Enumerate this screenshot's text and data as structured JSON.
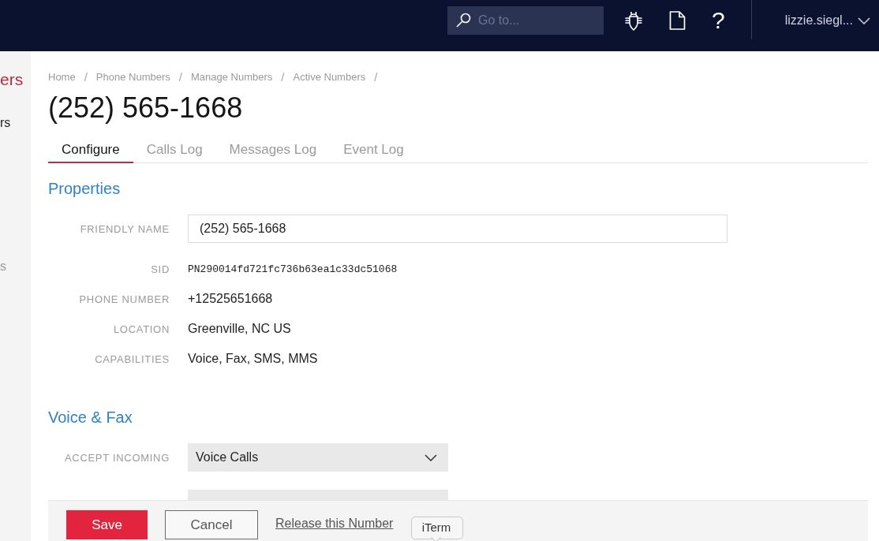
{
  "top_bar": {
    "search": {
      "placeholder": "Go to..."
    },
    "help": "?",
    "user": {
      "name": "lizzie.siegl...",
      "expanded": false
    }
  },
  "sidebar": {
    "heading": "ers",
    "items": [
      {
        "label": "rs",
        "selected": true
      },
      {
        "label": "s",
        "selected": false
      }
    ]
  },
  "breadcrumb": [
    {
      "label": "Home",
      "separator": "/"
    },
    {
      "label": "Phone Numbers",
      "separator": "/"
    },
    {
      "label": "Manage Numbers",
      "separator": "/"
    },
    {
      "label": "Active Numbers",
      "separator": "/"
    }
  ],
  "title": "(252) 565-1668",
  "tabs": [
    {
      "label": "Configure",
      "selected": true
    },
    {
      "label": "Calls Log",
      "selected": false
    },
    {
      "label": "Messages Log",
      "selected": false
    },
    {
      "label": "Event Log",
      "selected": false
    }
  ],
  "sections": [
    {
      "title": "Properties",
      "fields": [
        {
          "kind": "input",
          "label": "FRIENDLY NAME",
          "value": "(252) 565-1668"
        },
        {
          "kind": "code",
          "label": "SID",
          "value": "PN290014fd721fc736b63ea1c33dc51068"
        },
        {
          "kind": "text",
          "label": "PHONE NUMBER",
          "value": "+12525651668"
        },
        {
          "kind": "text",
          "label": "LOCATION",
          "value": "Greenville, NC US"
        },
        {
          "kind": "text",
          "label": "CAPABILITIES",
          "value": "Voice, Fax, SMS, MMS"
        }
      ]
    },
    {
      "title": "Voice & Fax",
      "fields": [
        {
          "kind": "select",
          "label": "ACCEPT INCOMING",
          "value": "Voice Calls"
        },
        {
          "kind": "covered_select"
        }
      ]
    }
  ],
  "footer": {
    "buttons": [
      {
        "kind": "primary",
        "label": "Save"
      },
      {
        "kind": "secondary",
        "label": "Cancel"
      },
      {
        "kind": "link",
        "label": "Release this Number"
      }
    ]
  },
  "dock_tooltip": {
    "label": "iTerm"
  }
}
